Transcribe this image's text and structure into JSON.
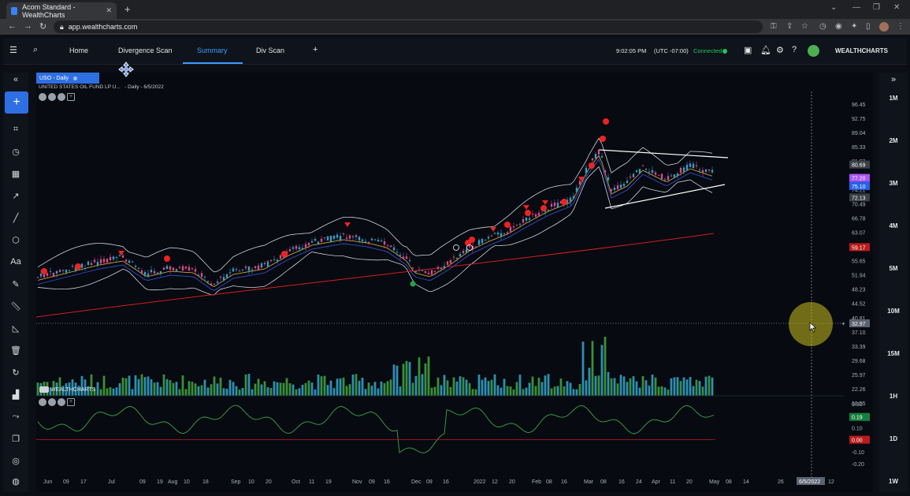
{
  "browser": {
    "tab_title": "Acom Standard - WealthCharts",
    "url": "app.wealthcharts.com"
  },
  "header": {
    "nav": [
      {
        "label": "Home"
      },
      {
        "label": "Divergence Scan"
      },
      {
        "label": "Summary"
      },
      {
        "label": "Div Scan"
      }
    ],
    "time": "9:02:05 PM",
    "timezone": "(UTC -07:00)",
    "status": "Connected",
    "brand": "WEALTHCHARTS"
  },
  "chart": {
    "symbol_badge": "USO - Daily",
    "symbol_name": "UNITED STATES OIL FUND LP U...",
    "period": "- Daily - 6/5/2022",
    "price_ticks": [
      "96.45",
      "92.75",
      "89.04",
      "85.33",
      "81.63",
      "77.92",
      "74.21",
      "70.49",
      "66.78",
      "63.07",
      "59.36",
      "55.65",
      "51.94",
      "48.23",
      "44.52",
      "40.81",
      "37.10",
      "33.39",
      "29.68",
      "25.97",
      "22.26",
      "18.55",
      "14.84"
    ],
    "price_badges": [
      {
        "value": "80.69",
        "color": "#3a3f48"
      },
      {
        "value": "77.20",
        "color": "#a855f7"
      },
      {
        "value": "75.10",
        "color": "#2563eb"
      },
      {
        "value": "72.13",
        "color": "#3a3f48"
      },
      {
        "value": "59.17",
        "color": "#b91c1c"
      }
    ],
    "crosshair_value": "32.97",
    "osc_ticks": [
      "0.30",
      "0.20",
      "0.10",
      "0.00",
      "-0.10",
      "-0.20"
    ],
    "osc_badges": [
      {
        "value": "0.19",
        "color": "#15803d"
      },
      {
        "value": "0.00",
        "color": "#b91c1c"
      }
    ],
    "x_ticks": [
      "Jun",
      "09",
      "17",
      "Jul",
      "09",
      "19",
      "Aug",
      "10",
      "18",
      "Sep",
      "10",
      "20",
      "Oct",
      "11",
      "19",
      "Nov",
      "09",
      "16",
      "Dec",
      "09",
      "16",
      "2022",
      "12",
      "20",
      "Feb",
      "08",
      "16",
      "Mar",
      "08",
      "16",
      "24",
      "Apr",
      "11",
      "20",
      "May",
      "08",
      "14",
      "26",
      "12"
    ],
    "x_crosshair_label": "6/5/2022",
    "watermark": "WEALTHCHARTS"
  },
  "timeframes": [
    "1M",
    "2M",
    "3M",
    "4M",
    "5M",
    "10M",
    "15M",
    "1H",
    "1D",
    "1W"
  ]
}
